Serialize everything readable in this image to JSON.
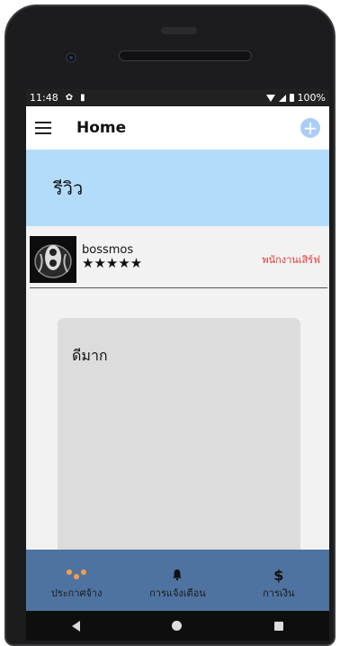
{
  "status_bar": {
    "time": "11:48",
    "battery": "100%",
    "icons": [
      "gear-icon",
      "sd-card-icon",
      "wifi-icon",
      "signal-icon",
      "battery-icon"
    ]
  },
  "app_bar": {
    "title": "Home",
    "menu_icon": "hamburger-menu-icon",
    "action_icon": "add-circle-icon",
    "add_symbol": "+"
  },
  "banner": {
    "title": "รีวิว",
    "background": "#b3dcfb"
  },
  "review": {
    "reviewer_name": "bossmos",
    "rating": 5,
    "stars": "★★★★★",
    "role": "พนักงานเสิร์ฟ",
    "role_color": "#e53935",
    "text": "ดีมาก"
  },
  "bottom_nav": {
    "background": "#4f73a0",
    "items": [
      {
        "label": "ประกาศจ้าง",
        "icon": "dots-icon"
      },
      {
        "label": "การแจ้งเตือน",
        "icon": "bell-icon",
        "glyph": "🔔"
      },
      {
        "label": "การเงิน",
        "icon": "dollar-icon",
        "glyph": "$"
      }
    ]
  },
  "system_nav": {
    "icons": [
      "back-icon",
      "home-icon",
      "recents-icon"
    ]
  }
}
